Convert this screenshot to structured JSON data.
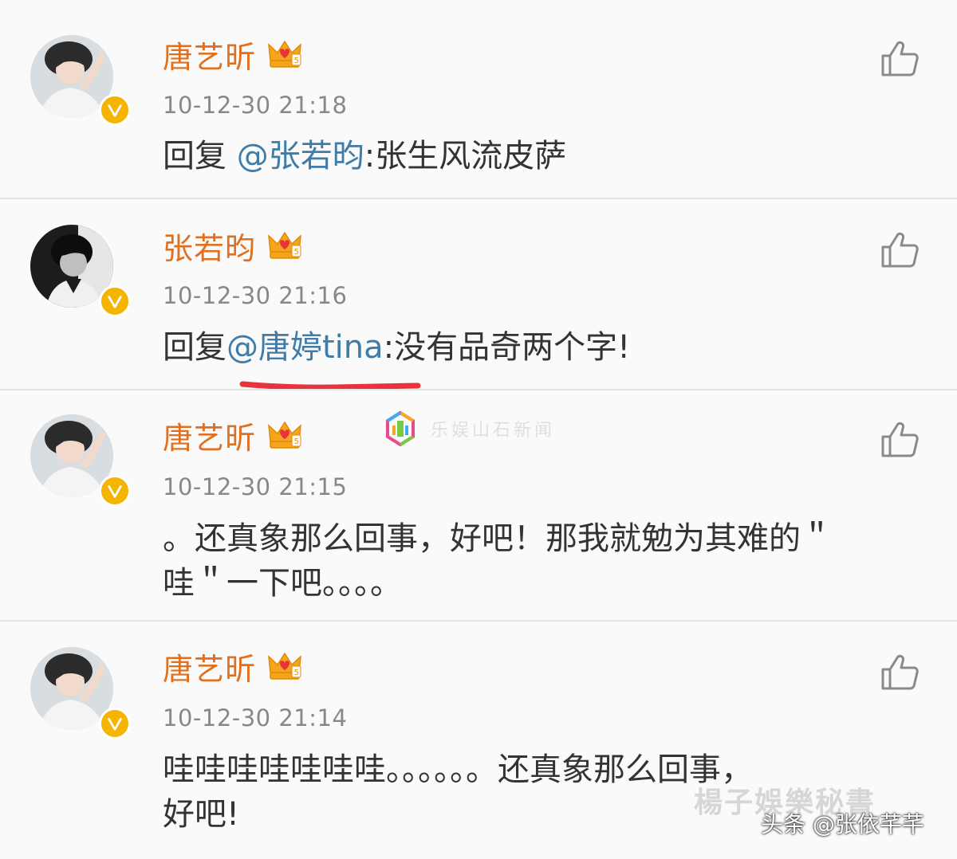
{
  "comments": [
    {
      "username": "唐艺昕",
      "timestamp": "10-12-30 21:18",
      "reply_prefix": "回复",
      "mention": "@张若昀",
      "text": ":张生风流皮萨"
    },
    {
      "username": "张若昀",
      "timestamp": "10-12-30 21:16",
      "reply_prefix": "回复",
      "mention": "@唐婷tina",
      "text": ":没有品奇两个字!"
    },
    {
      "username": "唐艺昕",
      "timestamp": "10-12-30 21:15",
      "text_line1": "。还真象那么回事，好吧！那我就勉为其难的＂",
      "text_line2": "哇＂一下吧。。。。"
    },
    {
      "username": "唐艺昕",
      "timestamp": "10-12-30 21:14",
      "text_line1": "哇哇哇哇哇哇哇。。。。。。还真象那么回事，",
      "text_line2": "好吧!"
    }
  ],
  "watermarks": {
    "site_text": "乐娱山石新闻",
    "faint_text": "楊子娛樂秘書",
    "credit": "头条 @张依芊芊"
  },
  "colors": {
    "username": "#e07020",
    "mention": "#3f7ca8",
    "verified_badge": "#f5b400",
    "underline": "#e8333c"
  },
  "icons": {
    "like": "thumbs-up-icon",
    "verified": "verified-v-icon",
    "vip": "crown-icon"
  }
}
